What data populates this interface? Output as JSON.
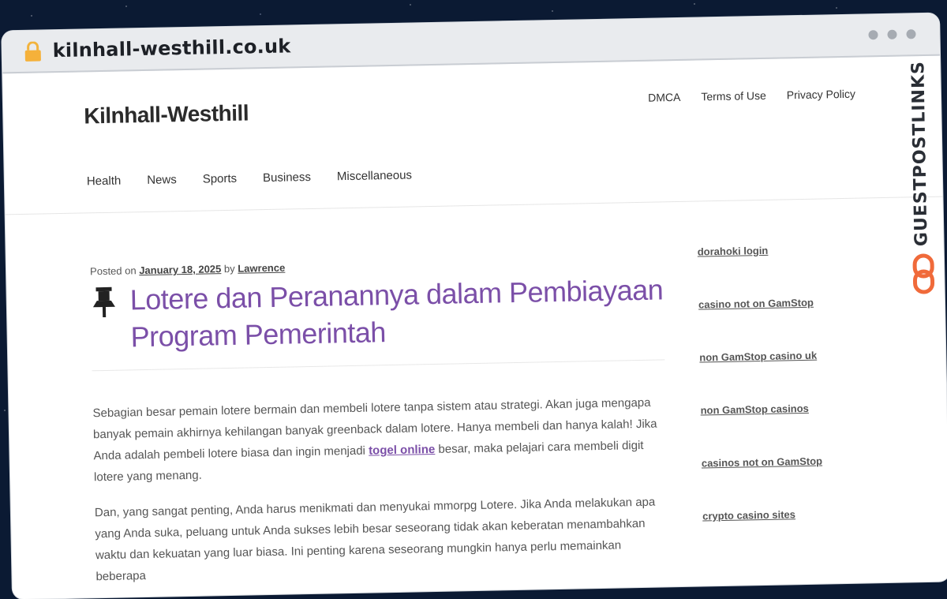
{
  "browser": {
    "url": "kilnhall-westhill.co.uk"
  },
  "site": {
    "title": "Kilnhall-Westhill",
    "top_links": [
      "DMCA",
      "Terms of Use",
      "Privacy Policy"
    ],
    "nav": [
      "Health",
      "News",
      "Sports",
      "Business",
      "Miscellaneous"
    ]
  },
  "post": {
    "posted_on_label": "Posted on",
    "date": "January 18, 2025",
    "by_label": "by",
    "author": "Lawrence",
    "title": "Lotere dan Peranannya dalam Pembiayaan Program Pemerintah",
    "p1_before": "Sebagian besar pemain lotere bermain dan membeli lotere tanpa sistem atau strategi. Akan juga mengapa banyak pemain akhirnya kehilangan banyak greenback dalam lotere. Hanya membeli dan hanya kalah! Jika Anda adalah pembeli lotere biasa dan ingin menjadi",
    "p1_link": "togel online",
    "p1_after": "besar, maka pelajari cara membeli digit lotere yang menang.",
    "p2": "Dan, yang sangat penting, Anda harus menikmati dan menyukai mmorpg Lotere. Jika Anda melakukan apa yang Anda suka, peluang untuk Anda sukses lebih besar seseorang tidak akan keberatan menambahkan waktu dan kekuatan yang luar biasa. Ini penting karena seseorang mungkin hanya perlu memainkan beberapa"
  },
  "sidebar": {
    "links": [
      "dorahoki login",
      "casino not on GamStop",
      "non GamStop casino uk",
      "non GamStop casinos",
      "casinos not on GamStop",
      "crypto casino sites"
    ]
  },
  "watermark": {
    "text": "GUESTPOSTLINKS",
    "accent_color": "#f06a3a"
  },
  "colors": {
    "title_purple": "#7b4fa8"
  }
}
